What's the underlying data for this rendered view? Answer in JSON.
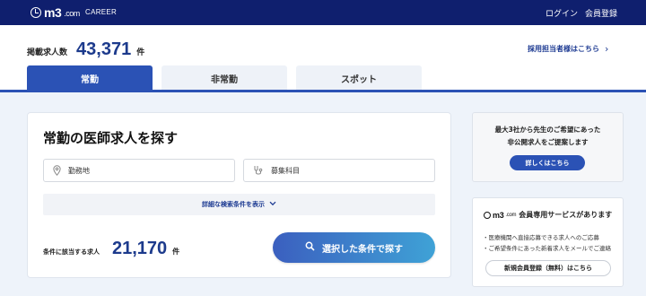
{
  "header": {
    "logo_text": "m3",
    "logo_domain": ".com",
    "career_label": "CAREER",
    "login_label": "ログイン",
    "register_label": "会員登録"
  },
  "summary": {
    "count_label": "掲載求人数",
    "count_value": "43,371",
    "count_unit": "件",
    "recruiter_link": "採用担当者様はこちら"
  },
  "tabs": [
    {
      "label": "常勤",
      "active": true
    },
    {
      "label": "非常勤",
      "active": false
    },
    {
      "label": "スポット",
      "active": false
    }
  ],
  "search": {
    "title": "常勤の医師求人を探す",
    "location_placeholder": "勤務地",
    "specialty_placeholder": "募集科目",
    "detail_toggle": "詳細な検索条件を表示",
    "match_label": "条件に該当する求人",
    "match_value": "21,170",
    "match_unit": "件",
    "submit_label": "選択した条件で探す"
  },
  "sidebar": {
    "promo_lines": [
      "最大3社から先生のご希望にあった",
      "非公開求人をご提案します"
    ],
    "promo_button": "詳しくはこちら",
    "member_logo_text": "m3",
    "member_logo_domain": ".com",
    "member_title": "会員専用サービスがあります",
    "member_bullets": [
      "・医療機関へ直接応募できる求人へのご応募",
      "・ご希望条件にあった新着求人をメールでご連絡"
    ],
    "member_button": "新規会員登録（無料）はこちら"
  },
  "colors": {
    "navy": "#0f1f6e",
    "primary": "#2b52b5",
    "count_text": "#1c3a8c",
    "background_light": "#eef3fa"
  }
}
